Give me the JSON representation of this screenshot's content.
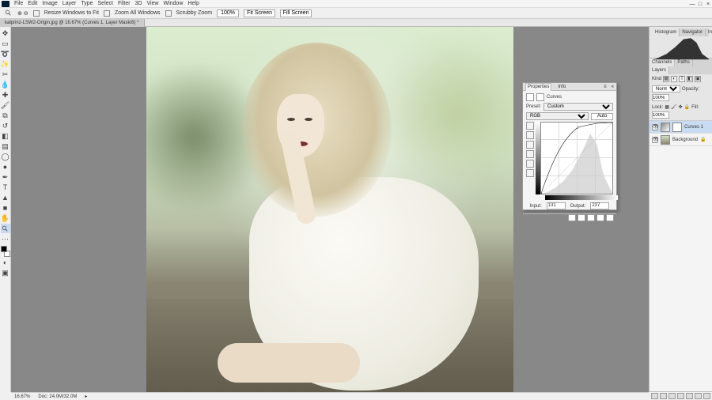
{
  "menu": {
    "items": [
      "File",
      "Edit",
      "Image",
      "Layer",
      "Type",
      "Select",
      "Filter",
      "3D",
      "View",
      "Window",
      "Help"
    ]
  },
  "window_controls": {
    "min": "—",
    "max": "□",
    "close": "×"
  },
  "options_bar": {
    "tool_icon": "zoom-icon",
    "resize_label": "Resize Windows to Fit",
    "zoom_all_label": "Zoom All Windows",
    "scrubby_label": "Scrubby Zoom",
    "btn_100": "100%",
    "btn_fit": "Fit Screen",
    "btn_fill": "Fill Screen"
  },
  "document": {
    "tab_title": "kalprinz-LSW2-Origin.jpg @ 16.67% (Curves 1, Layer Mask/8) *"
  },
  "tools": [
    "move",
    "rect-marquee",
    "lasso",
    "magic-wand",
    "crop",
    "eyedropper",
    "spot-heal",
    "brush",
    "clone-stamp",
    "history-brush",
    "eraser",
    "gradient",
    "blur",
    "dodge",
    "pen",
    "type",
    "path-select",
    "rectangle",
    "hand",
    "zoom",
    "edit-toolbar"
  ],
  "histogram_panel": {
    "tabs": [
      "Histogram",
      "Navigator",
      "Info"
    ],
    "active_tab": "Histogram"
  },
  "channels_panel": {
    "tabs": [
      "Channels",
      "Paths"
    ],
    "active_tab": "Channels"
  },
  "layers_panel": {
    "tabs": [
      "Layers"
    ],
    "kind_label": "Kind",
    "blend_mode": "Normal",
    "opacity_label": "Opacity:",
    "opacity_value": "100%",
    "lock_label": "Lock:",
    "fill_label": "Fill:",
    "fill_value": "100%",
    "layers": [
      {
        "name": "Curves 1",
        "visible": true,
        "selected": true,
        "has_mask": true,
        "is_adjustment": true
      },
      {
        "name": "Background",
        "visible": true,
        "selected": false,
        "has_mask": false,
        "locked": true
      }
    ]
  },
  "properties_panel": {
    "tabs": [
      "Properties",
      "Info"
    ],
    "active_tab": "Properties",
    "adjustment_label": "Curves",
    "preset_label": "Preset:",
    "preset_value": "Custom",
    "channel_value": "RGB",
    "auto_btn": "Auto",
    "input_label": "Input:",
    "input_value": "131",
    "output_label": "Output:",
    "output_value": "237"
  },
  "status": {
    "zoom": "16.67%",
    "doc_info": "Doc: 24.0M/32.0M"
  },
  "chart_data": [
    {
      "type": "area",
      "title": "Histogram",
      "x": [
        0,
        32,
        64,
        96,
        128,
        160,
        192,
        224,
        255
      ],
      "values": [
        0,
        2,
        8,
        20,
        58,
        95,
        100,
        40,
        5
      ],
      "xlim": [
        0,
        255
      ],
      "ylim": [
        0,
        100
      ]
    },
    {
      "type": "line",
      "title": "Curves",
      "series": [
        {
          "name": "curve",
          "x": [
            0,
            40,
            80,
            131,
            180,
            220,
            255
          ],
          "y": [
            0,
            120,
            200,
            237,
            252,
            255,
            255
          ]
        },
        {
          "name": "baseline",
          "x": [
            0,
            255
          ],
          "y": [
            0,
            255
          ]
        }
      ],
      "histogram_overlay": {
        "x": [
          0,
          32,
          64,
          96,
          128,
          160,
          192,
          224,
          255
        ],
        "values": [
          0,
          4,
          12,
          28,
          60,
          92,
          100,
          35,
          2
        ]
      },
      "xlabel": "Input",
      "ylabel": "Output",
      "xlim": [
        0,
        255
      ],
      "ylim": [
        0,
        255
      ]
    }
  ]
}
